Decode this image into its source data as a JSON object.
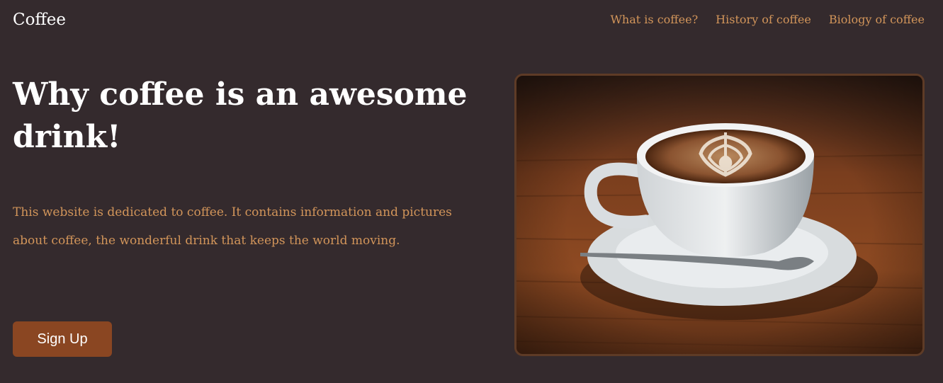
{
  "header": {
    "brand": "Coffee",
    "nav": [
      {
        "label": "What is coffee?"
      },
      {
        "label": "History of coffee"
      },
      {
        "label": "Biology of coffee"
      }
    ]
  },
  "hero": {
    "title": "Why coffee is an awesome drink!",
    "description": "This website is dedicated to coffee. It contains information and pictures about coffee, the wonderful drink that keeps the world moving.",
    "cta_label": "Sign Up"
  },
  "image": {
    "alt": "coffee-cup-latte-art-on-wooden-table"
  },
  "colors": {
    "background": "#342a2d",
    "accent": "#d2955a",
    "button": "#8a4622",
    "text": "#ffffff"
  }
}
